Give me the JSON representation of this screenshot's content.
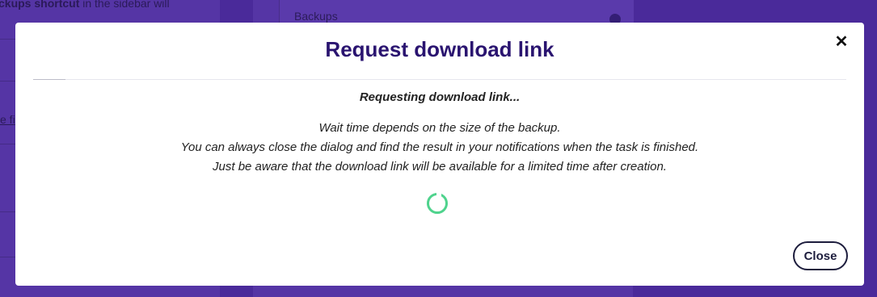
{
  "background": {
    "left_text_bold": "ckups shortcut",
    "left_text_rest": " in the sidebar will",
    "left_link": "e fi",
    "center_label": "Backups"
  },
  "modal": {
    "title": "Request download link",
    "close_icon": "close-icon",
    "status": "Requesting download link...",
    "lines": [
      "Wait time depends on the size of the backup.",
      "You can always close the dialog and find the result in your notifications when the task is finished.",
      "Just be aware that the download link will be available for a limited time after creation."
    ],
    "spinner_icon": "loading-spinner-icon",
    "close_button": "Close"
  },
  "colors": {
    "overlay": "#4a2a9a",
    "title": "#2a1470",
    "spinner": "#4fd38d"
  }
}
